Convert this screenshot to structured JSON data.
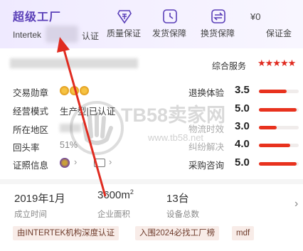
{
  "header": {
    "brand": "超级工厂",
    "brand_sub": "Intertek",
    "brand_sub2": "认证",
    "items": [
      {
        "label": "质量保证",
        "icon": "quality-icon"
      },
      {
        "label": "发货保障",
        "icon": "clock-icon"
      },
      {
        "label": "换货保障",
        "icon": "exchange-icon"
      },
      {
        "label": "保证金",
        "icon": ""
      }
    ],
    "price": "¥0"
  },
  "score": {
    "title": "综合服务",
    "stars": "★★★★★"
  },
  "info": [
    {
      "label": "交易勋章",
      "value": ""
    },
    {
      "label": "经营模式",
      "value": "生产型|已认证"
    },
    {
      "label": "所在地区",
      "value": ""
    },
    {
      "label": "回头率",
      "value": "51%"
    },
    {
      "label": "证照信息",
      "value": ""
    }
  ],
  "ratings": [
    {
      "label": "退换体验",
      "score": "3.5",
      "fill": 0.7
    },
    {
      "label": "",
      "score": "5.0",
      "fill": 0.95
    },
    {
      "label": "物流时效",
      "score": "3.0",
      "fill": 0.45
    },
    {
      "label": "纠纷解决",
      "score": "4.0",
      "fill": 0.78
    },
    {
      "label": "采购咨询",
      "score": "5.0",
      "fill": 0.95
    }
  ],
  "stats": [
    {
      "value": "2019年1月",
      "label": "成立时间"
    },
    {
      "value": "3600m",
      "sup": "2",
      "label": "企业面积"
    },
    {
      "value": "13台",
      "label": "设备总数"
    }
  ],
  "tags": [
    "由INTERTEK机构深度认证",
    "入围2024必找工厂榜",
    "mdf"
  ],
  "watermark": {
    "main": "TB58卖家网",
    "url": "www.tb58.net"
  }
}
